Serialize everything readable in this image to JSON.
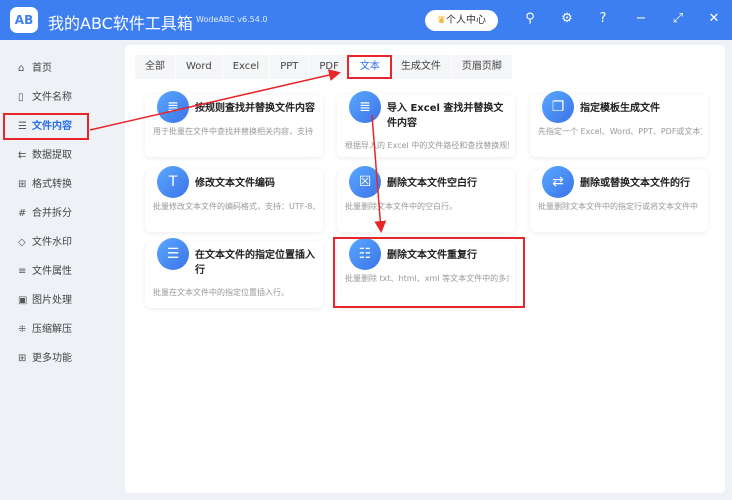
{
  "app": {
    "logo": "AB",
    "title": "我的ABC软件工具箱",
    "version": "WodeABC v6.54.0",
    "user_center": "个人中心"
  },
  "window_icons": [
    "search-icon",
    "gear-icon",
    "help-icon",
    "minimize-icon",
    "maximize-icon",
    "close-icon"
  ],
  "sidebar": {
    "items": [
      {
        "label": "首页",
        "icon": "⌂"
      },
      {
        "label": "文件名称",
        "icon": "▯"
      },
      {
        "label": "文件内容",
        "icon": "☰"
      },
      {
        "label": "数据提取",
        "icon": "⇇"
      },
      {
        "label": "格式转换",
        "icon": "⊞"
      },
      {
        "label": "合并拆分",
        "icon": "#"
      },
      {
        "label": "文件水印",
        "icon": "◇"
      },
      {
        "label": "文件属性",
        "icon": "≡"
      },
      {
        "label": "图片处理",
        "icon": "▣"
      },
      {
        "label": "压缩解压",
        "icon": "⁜"
      },
      {
        "label": "更多功能",
        "icon": "⊞"
      }
    ],
    "active": "文件内容"
  },
  "tabs": [
    "全部",
    "Word",
    "Excel",
    "PPT",
    "PDF",
    "文本",
    "生成文件",
    "页眉页脚"
  ],
  "active_tab": "文本",
  "cards": [
    {
      "title": "按规则查找并替换文件内容",
      "desc": "用于批量在文件中查找并替换相关内容，支持",
      "icon": "≣"
    },
    {
      "title": "导入 Excel 查找并替换文件内容",
      "desc": "根据导入的 Excel 中的文件路径和查找替换规则",
      "icon": "≣"
    },
    {
      "title": "指定模板生成文件",
      "desc": "先指定一个 Excel、Word、PPT、PDF或文本文",
      "icon": "❐"
    },
    {
      "title": "修改文本文件编码",
      "desc": "批量修改文本文件的编码格式，支持：UTF-8、",
      "icon": "T"
    },
    {
      "title": "删除文本文件空白行",
      "desc": "批量删除文本文件中的空白行。",
      "icon": "☒"
    },
    {
      "title": "删除或替换文本文件的行",
      "desc": "批量删除文本文件中的指定行或将文本文件中",
      "icon": "⇄"
    },
    {
      "title": "在文本文件的指定位置插入行",
      "desc": "批量在文本文件中的指定位置插入行。",
      "icon": "☰"
    },
    {
      "title": "删除文本文件重复行",
      "desc": "批量删除 txt、html、xml 等文本文件中的多余",
      "icon": "☷"
    }
  ],
  "colors": {
    "brand": "#3d7ff0",
    "highlight": "#e8262a"
  }
}
